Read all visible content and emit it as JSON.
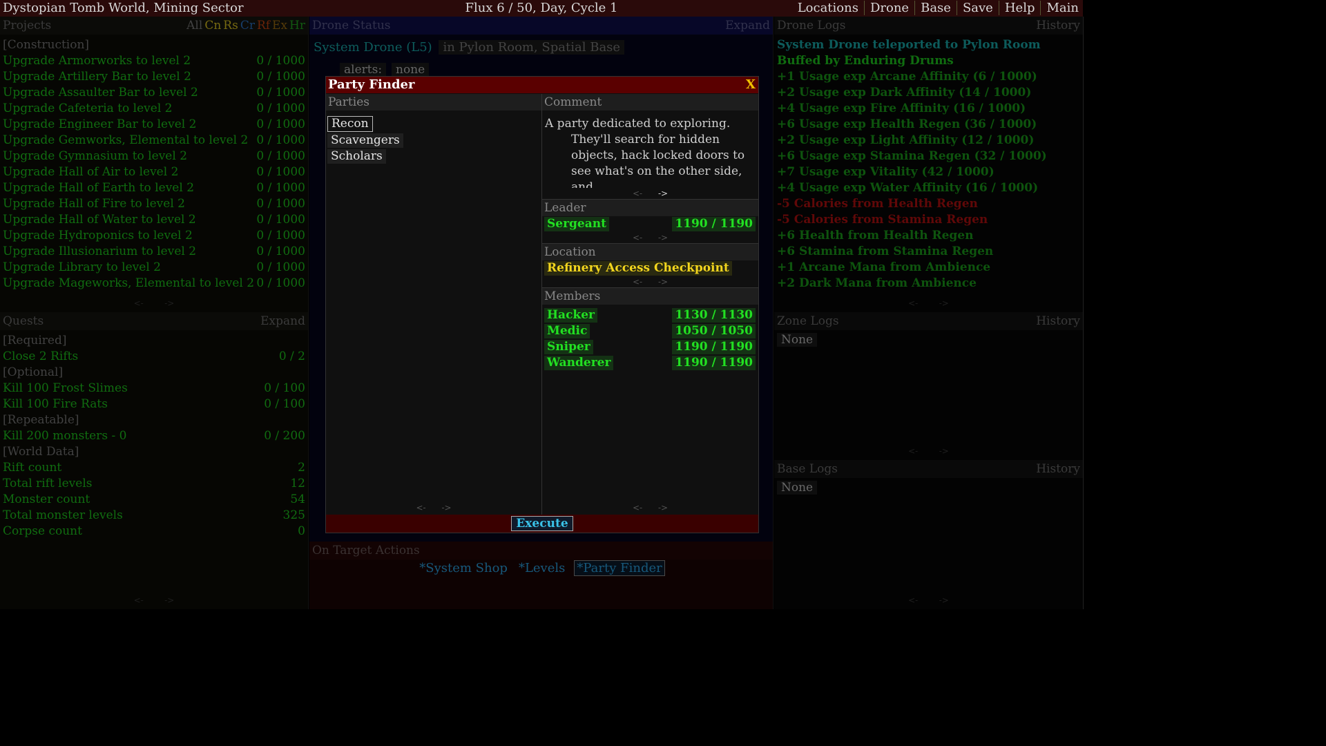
{
  "topbar": {
    "title": "Dystopian Tomb World, Mining Sector",
    "status": "Flux 6 / 50, Day, Cycle 1",
    "menu": [
      "Locations",
      "Drone",
      "Base",
      "Save",
      "Help",
      "Main"
    ]
  },
  "projects": {
    "title": "Projects",
    "filters": [
      {
        "label": "All",
        "color": "#777777"
      },
      {
        "label": "Cn",
        "color": "#d8c020"
      },
      {
        "label": "Rs",
        "color": "#d8c020"
      },
      {
        "label": "Cr",
        "color": "#2a70c0"
      },
      {
        "label": "Rf",
        "color": "#c04010"
      },
      {
        "label": "Ex",
        "color": "#9a6a10"
      },
      {
        "label": "Hr",
        "color": "#20a020"
      }
    ],
    "category": "[Construction]",
    "items": [
      {
        "name": "Upgrade Armorworks to level 2",
        "progress": "0 / 1000"
      },
      {
        "name": "Upgrade Artillery Bar to level 2",
        "progress": "0 / 1000"
      },
      {
        "name": "Upgrade Assaulter Bar to level 2",
        "progress": "0 / 1000"
      },
      {
        "name": "Upgrade Cafeteria to level 2",
        "progress": "0 / 1000"
      },
      {
        "name": "Upgrade Engineer Bar to level 2",
        "progress": "0 / 1000"
      },
      {
        "name": "Upgrade Gemworks, Elemental to level 2",
        "progress": "0 / 1000"
      },
      {
        "name": "Upgrade Gymnasium to level 2",
        "progress": "0 / 1000"
      },
      {
        "name": "Upgrade Hall of Air to level 2",
        "progress": "0 / 1000"
      },
      {
        "name": "Upgrade Hall of Earth to level 2",
        "progress": "0 / 1000"
      },
      {
        "name": "Upgrade Hall of Fire to level 2",
        "progress": "0 / 1000"
      },
      {
        "name": "Upgrade Hall of Water to level 2",
        "progress": "0 / 1000"
      },
      {
        "name": "Upgrade Hydroponics to level 2",
        "progress": "0 / 1000"
      },
      {
        "name": "Upgrade Illusionarium to level 2",
        "progress": "0 / 1000"
      },
      {
        "name": "Upgrade Library to level 2",
        "progress": "0 / 1000"
      },
      {
        "name": "Upgrade Mageworks, Elemental to level 2",
        "progress": "0 / 1000"
      }
    ]
  },
  "quests": {
    "title": "Quests",
    "expand": "Expand",
    "rows": [
      {
        "label": "[Required]",
        "value": "",
        "kind": "head"
      },
      {
        "label": "Close 2 Rifts",
        "value": "0 / 2",
        "kind": "item"
      },
      {
        "label": "[Optional]",
        "value": "",
        "kind": "head"
      },
      {
        "label": "Kill 100 Frost Slimes",
        "value": "0 / 100",
        "kind": "item"
      },
      {
        "label": "Kill 100 Fire Rats",
        "value": "0 / 100",
        "kind": "item"
      },
      {
        "label": "[Repeatable]",
        "value": "",
        "kind": "head"
      },
      {
        "label": "Kill 200 monsters - 0",
        "value": "0 / 200",
        "kind": "item"
      },
      {
        "label": "[World Data]",
        "value": "",
        "kind": "head"
      },
      {
        "label": "Rift count",
        "value": "2",
        "kind": "item"
      },
      {
        "label": "Total rift levels",
        "value": "12",
        "kind": "item"
      },
      {
        "label": "Monster count",
        "value": "54",
        "kind": "item"
      },
      {
        "label": "Total monster levels",
        "value": "325",
        "kind": "item"
      },
      {
        "label": "Corpse count",
        "value": "0",
        "kind": "item"
      }
    ]
  },
  "drone": {
    "title": "Drone Status",
    "expand": "Expand",
    "name": "System Drone (L5)",
    "location": "in Pylon Room, Spatial Base",
    "alerts_label": "alerts:",
    "alerts_value": "none"
  },
  "target_actions": {
    "title": "On Target Actions",
    "items": [
      {
        "label": "*System Shop",
        "selected": false
      },
      {
        "label": "*Levels",
        "selected": false
      },
      {
        "label": "*Party Finder",
        "selected": true
      }
    ]
  },
  "drone_logs": {
    "title": "Drone Logs",
    "history": "History",
    "entries": [
      {
        "text": "System Drone teleported to Pylon Room",
        "color": "cyan"
      },
      {
        "text": "Buffed by Enduring Drums",
        "color": "green"
      },
      {
        "text": "+1 Usage exp Arcane Affinity (6 / 1000)",
        "color": "green2"
      },
      {
        "text": "+2 Usage exp Dark Affinity (14 / 1000)",
        "color": "green2"
      },
      {
        "text": "+4 Usage exp Fire Affinity (16 / 1000)",
        "color": "green2"
      },
      {
        "text": "+6 Usage exp Health Regen (36 / 1000)",
        "color": "green2"
      },
      {
        "text": "+2 Usage exp Light Affinity (12 / 1000)",
        "color": "green2"
      },
      {
        "text": "+6 Usage exp Stamina Regen (32 / 1000)",
        "color": "green2"
      },
      {
        "text": "+7 Usage exp Vitality (42 / 1000)",
        "color": "green2"
      },
      {
        "text": "+4 Usage exp Water Affinity (16 / 1000)",
        "color": "green2"
      },
      {
        "text": "-5 Calories from Health Regen",
        "color": "red"
      },
      {
        "text": "-5 Calories from Stamina Regen",
        "color": "red"
      },
      {
        "text": "+6 Health from Health Regen",
        "color": "green2"
      },
      {
        "text": "+6 Stamina from Stamina Regen",
        "color": "green2"
      },
      {
        "text": "+1 Arcane Mana from Ambience",
        "color": "green2"
      },
      {
        "text": "+2 Dark Mana from Ambience",
        "color": "green2"
      }
    ]
  },
  "zone_logs": {
    "title": "Zone Logs",
    "history": "History",
    "empty": "None"
  },
  "base_logs": {
    "title": "Base Logs",
    "history": "History",
    "empty": "None"
  },
  "pager": {
    "prev": "<-",
    "next": "->"
  },
  "party_finder": {
    "title": "Party Finder",
    "close": "X",
    "parties_label": "Parties",
    "parties": [
      "Recon",
      "Scavengers",
      "Scholars"
    ],
    "selected_party": "Recon",
    "comment_label": "Comment",
    "comment_lines": [
      "A party dedicated to exploring.",
      "They'll search for hidden",
      "objects, hack locked doors to",
      "see what's on the other side, and"
    ],
    "leader_label": "Leader",
    "leader": {
      "name": "Sergeant",
      "hp": "1190 / 1190"
    },
    "location_label": "Location",
    "location": "Refinery Access Checkpoint",
    "members_label": "Members",
    "members": [
      {
        "name": "Hacker",
        "hp": "1130 / 1130"
      },
      {
        "name": "Medic",
        "hp": "1050 / 1050"
      },
      {
        "name": "Sniper",
        "hp": "1190 / 1190"
      },
      {
        "name": "Wanderer",
        "hp": "1190 / 1190"
      }
    ],
    "execute": "Execute"
  }
}
